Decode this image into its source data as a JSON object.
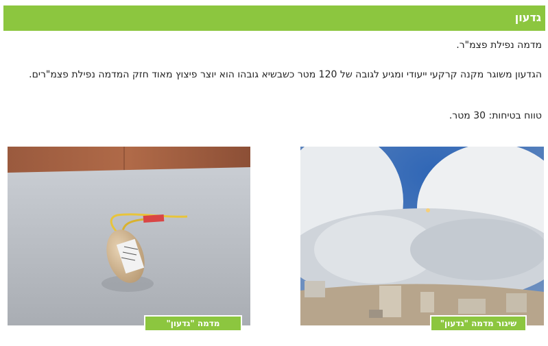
{
  "header": {
    "title": "גדעון"
  },
  "content": {
    "line1": "מדמה נפילת פצמ\"ר.",
    "description": "הגדעון משוגר מקנה קרקעי ייעודי ומגיע לגובה של 120 מטר כשבשיא גובהו הוא יוצר פיצוץ מאוד חזק המדמה נפילת פצמ\"רים.",
    "safety": "טווח בטיחות: 30 מטר."
  },
  "images": {
    "left_caption": "מדמה \"גדעון\"",
    "right_caption": "שיגור מדמה \"גדעון\""
  }
}
